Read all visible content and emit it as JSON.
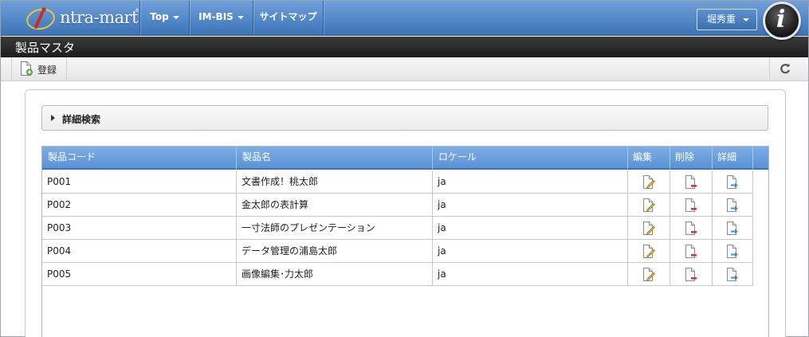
{
  "app": {
    "logo_text": "ntra-mart",
    "logo_mark": "®",
    "nav": [
      {
        "label": "Top",
        "has_dropdown": true
      },
      {
        "label": "IM-BIS",
        "has_dropdown": true
      },
      {
        "label": "サイトマップ",
        "has_dropdown": false
      }
    ],
    "user_label": "堀秀重",
    "avatar_letter": "i"
  },
  "page": {
    "title": "製品マスタ"
  },
  "toolbar": {
    "register_label": "登録",
    "register_icon": "add-document-icon",
    "refresh_icon": "refresh-icon"
  },
  "search": {
    "label": "詳細検索"
  },
  "grid": {
    "columns": [
      "製品コード",
      "製品名",
      "ロケール",
      "編集",
      "削除",
      "詳細"
    ],
    "rows": [
      {
        "code": "P001",
        "name": "文書作成！桃太郎",
        "locale": "ja"
      },
      {
        "code": "P002",
        "name": "金太郎の表計算",
        "locale": "ja"
      },
      {
        "code": "P003",
        "name": "一寸法師のプレゼンテーション",
        "locale": "ja"
      },
      {
        "code": "P004",
        "name": "データ管理の浦島太郎",
        "locale": "ja"
      },
      {
        "code": "P005",
        "name": "画像編集･力太郎",
        "locale": "ja"
      }
    ],
    "row_icons": {
      "edit": "edit-document-icon",
      "delete": "delete-document-icon",
      "detail": "detail-document-icon"
    }
  },
  "colors": {
    "nav_blue": "#3c74b8",
    "header_blue": "#5b93d6",
    "title_bar": "#1c1c1c"
  }
}
